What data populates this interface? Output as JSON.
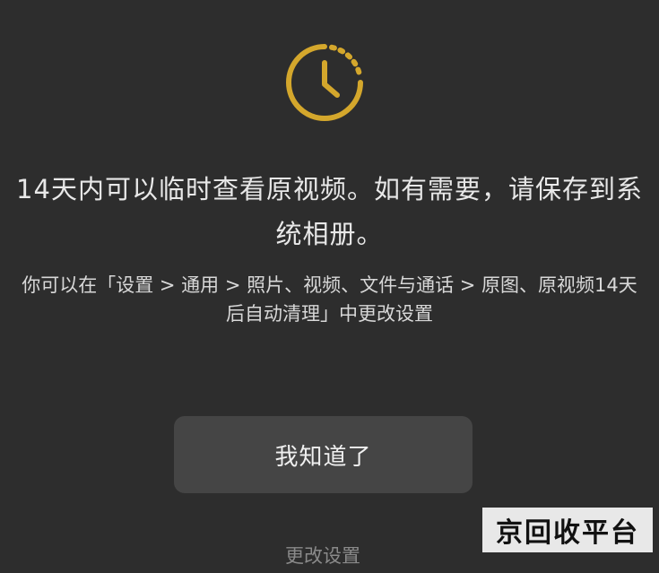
{
  "dialog": {
    "headline": "14天内可以临时查看原视频。如有需要，请保存到系统相册。",
    "description": "你可以在「设置 > 通用 > 照片、视频、文件与通话 > 原图、原视频14天后自动清理」中更改设置",
    "ok_button_label": "我知道了",
    "change_settings_label": "更改设置"
  },
  "watermark": {
    "text": "京回收平台"
  },
  "colors": {
    "background": "#2d2d2d",
    "accent": "#d4a72c",
    "button": "#454545"
  },
  "icons": {
    "top": "clock-icon"
  }
}
